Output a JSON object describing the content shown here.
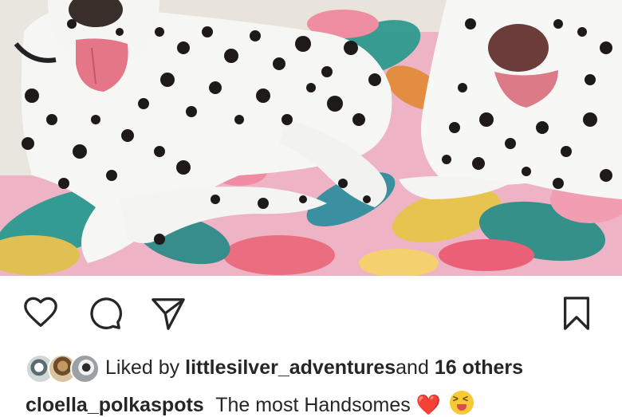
{
  "post": {
    "likes": {
      "prefix": "Liked by",
      "user": "littlesilver_adventures",
      "conjunction": "and",
      "others": "16 others"
    },
    "caption": {
      "username": "cloella_polkaspots",
      "text": "The most Handsomes",
      "emojis": [
        "❤️",
        "😝"
      ]
    }
  },
  "icons": {
    "like": "heart-outline-icon",
    "comment": "comment-bubble-icon",
    "share": "paper-plane-icon",
    "save": "bookmark-icon"
  },
  "colors": {
    "icon": "#262626",
    "text": "#262626",
    "heart_emoji": "#e0142e",
    "face_emoji": "#f7c934"
  }
}
